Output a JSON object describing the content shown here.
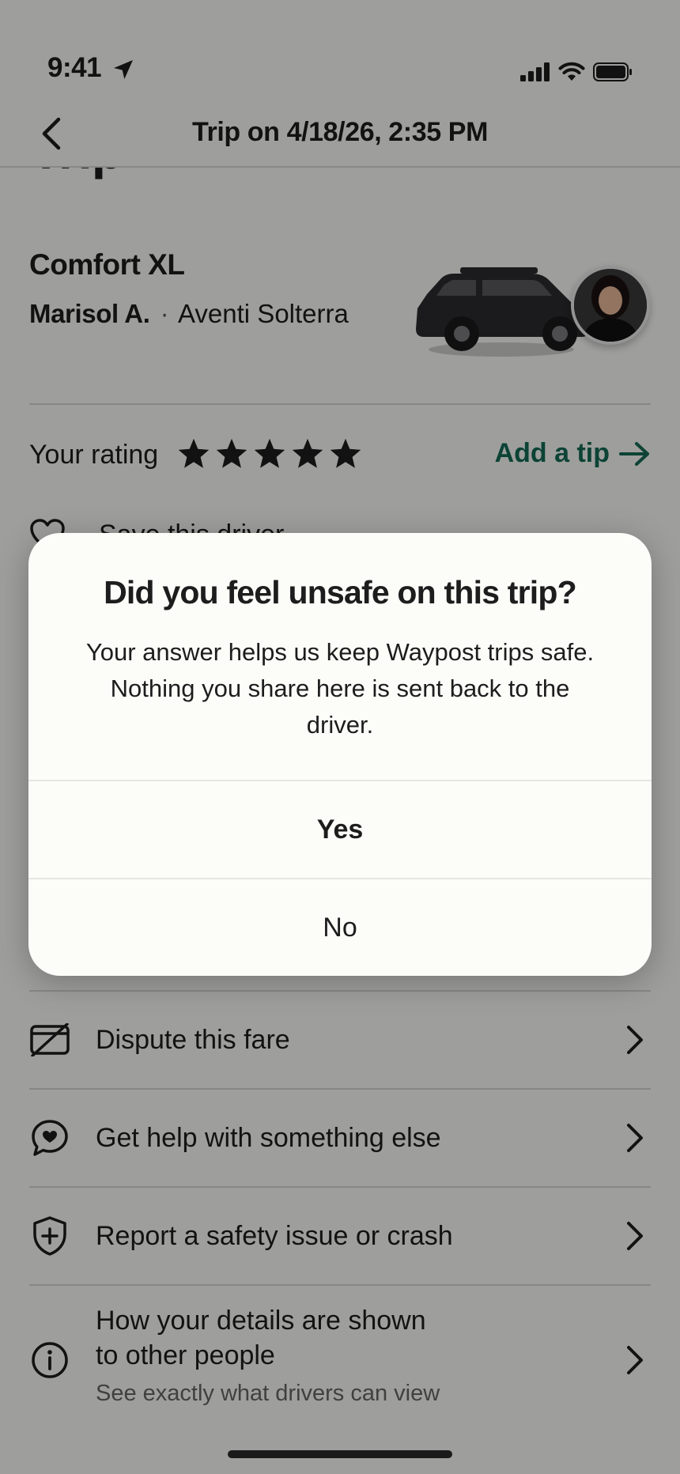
{
  "status_bar": {
    "time": "9:41"
  },
  "nav": {
    "title": "Trip on 4/18/26, 2:35 PM"
  },
  "trip": {
    "heading": "Trip",
    "vehicle_class": "Comfort XL",
    "driver_name": "Marisol A.",
    "separator": "·",
    "vehicle_model": "Aventi Solterra"
  },
  "rating": {
    "label": "Your rating",
    "stars": 5,
    "max_stars": 5,
    "tip_label": "Add a tip"
  },
  "save_driver": {
    "label": "Save this driver"
  },
  "list": [
    {
      "icon": "credit-card-slash-icon",
      "label": "Dispute this fare"
    },
    {
      "icon": "chat-heart-icon",
      "label": "Get help with something else"
    },
    {
      "icon": "shield-plus-icon",
      "label": "Report a safety issue or crash"
    },
    {
      "icon": "info-icon",
      "label_line1": "How your details are shown",
      "label_line2": "to other people",
      "sublabel": "See exactly what drivers can view"
    }
  ],
  "dialog": {
    "title": "Did you feel unsafe on this trip?",
    "body": "Your answer helps us keep Waypost trips safe. Nothing you share here is sent back to the driver.",
    "yes_label": "Yes",
    "no_label": "No"
  },
  "colors": {
    "accent": "#146b54",
    "background": "#fbfbf8",
    "text": "#1d1d1d"
  }
}
